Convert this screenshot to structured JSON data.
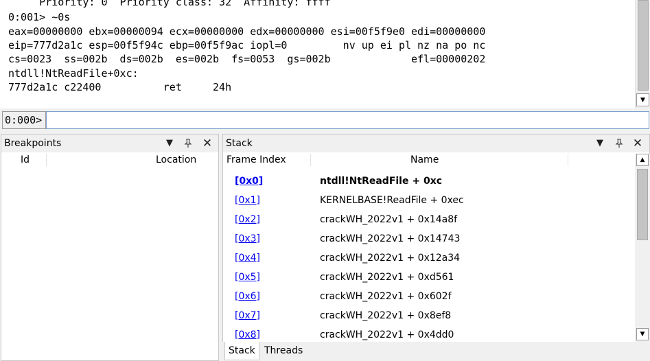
{
  "command_window": {
    "lines": [
      "     Priority: 0  Priority class: 32  Affinity: ffff",
      "0:001> ~0s",
      "eax=00000000 ebx=00000094 ecx=00000000 edx=00000000 esi=00f5f9e0 edi=00000000",
      "eip=777d2a1c esp=00f5f94c ebp=00f5f9ac iopl=0         nv up ei pl nz na po nc",
      "cs=0023  ss=002b  ds=002b  es=002b  fs=0053  gs=002b             efl=00000202",
      "ntdll!NtReadFile+0xc:",
      "777d2a1c c22400          ret     24h"
    ],
    "prompt": "0:000>",
    "input_value": ""
  },
  "breakpoints": {
    "title": "Breakpoints",
    "columns": [
      "Id",
      "Location"
    ]
  },
  "stack": {
    "title": "Stack",
    "columns": [
      "Frame Index",
      "Name"
    ],
    "frames": [
      {
        "index": "[0x0]",
        "name": "ntdll!NtReadFile + 0xc",
        "current": true
      },
      {
        "index": "[0x1]",
        "name": "KERNELBASE!ReadFile + 0xec"
      },
      {
        "index": "[0x2]",
        "name": "crackWH_2022v1 + 0x14a8f"
      },
      {
        "index": "[0x3]",
        "name": "crackWH_2022v1 + 0x14743"
      },
      {
        "index": "[0x4]",
        "name": "crackWH_2022v1 + 0x12a34"
      },
      {
        "index": "[0x5]",
        "name": "crackWH_2022v1 + 0xd561"
      },
      {
        "index": "[0x6]",
        "name": "crackWH_2022v1 + 0x602f"
      },
      {
        "index": "[0x7]",
        "name": "crackWH_2022v1 + 0x8ef8"
      },
      {
        "index": "[0x8]",
        "name": "crackWH_2022v1 + 0x4dd0"
      }
    ]
  },
  "bottom_tabs": [
    "Stack",
    "Threads"
  ],
  "icons": {
    "dropdown": "chevron-down-icon",
    "pin": "pin-icon",
    "close": "close-icon"
  },
  "colors": {
    "link": "#0000ee",
    "input_border": "#7da2ce"
  }
}
